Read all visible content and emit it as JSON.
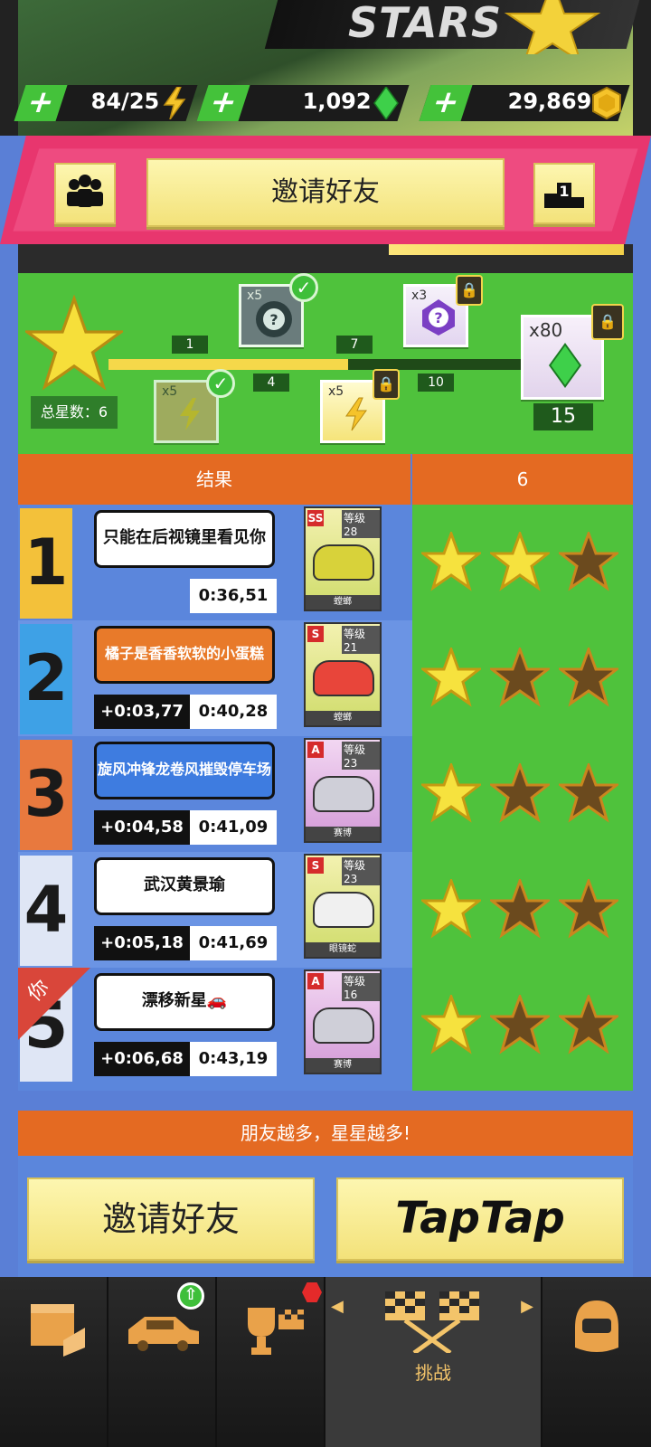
{
  "hero": {
    "title": "STARS"
  },
  "resources": [
    {
      "plus": "+",
      "value": "84/25",
      "icon": "lightning-icon"
    },
    {
      "plus": "+",
      "value": "1,092",
      "icon": "green-gem-icon"
    },
    {
      "plus": "+",
      "value": "29,869",
      "icon": "gold-coin-icon"
    }
  ],
  "topbar": {
    "invite_label": "邀请好友",
    "rank_value": "1"
  },
  "progress": {
    "total_label": "总星数：6",
    "milestones": [
      "1",
      "4",
      "7",
      "10",
      "15"
    ],
    "rewards": [
      {
        "mult": "x5",
        "kind": "lightning",
        "claimed": true
      },
      {
        "mult": "x5",
        "kind": "mystery-tire",
        "claimed": true
      },
      {
        "mult": "x5",
        "kind": "lightning",
        "claimed": false
      },
      {
        "mult": "x3",
        "kind": "mystery-gem",
        "claimed": false
      },
      {
        "mult": "x80",
        "kind": "green-gem",
        "claimed": false
      }
    ]
  },
  "table": {
    "header_result": "结果",
    "header_score": "6",
    "rows": [
      {
        "rank": "1",
        "name": "只能在后视镜里看见你",
        "gap": "",
        "time": "0:36,51",
        "car_class": "SS",
        "level": "等级28",
        "car_name": "螳螂",
        "stars": 2,
        "rank_color": "#f3c13a",
        "plate_color": "#ffffff",
        "car_color": "#d8d23a"
      },
      {
        "rank": "2",
        "name": "橘子是香香软软的小蛋糕",
        "gap": "+0:03,77",
        "time": "0:40,28",
        "car_class": "S",
        "level": "等级21",
        "car_name": "螳螂",
        "stars": 1,
        "rank_color": "#3ea1e6",
        "plate_color": "#e87a2a",
        "car_color": "#e8453a"
      },
      {
        "rank": "3",
        "name": "旋风冲锋龙卷风摧毁停车场",
        "gap": "+0:04,58",
        "time": "0:41,09",
        "car_class": "A",
        "level": "等级23",
        "car_name": "赛博",
        "stars": 1,
        "rank_color": "#e8793e",
        "plate_color": "#3e7ce0",
        "car_color": "#cfcfd8"
      },
      {
        "rank": "4",
        "name": "武汉黄景瑜",
        "gap": "+0:05,18",
        "time": "0:41,69",
        "car_class": "S",
        "level": "等级23",
        "car_name": "眼镜蛇",
        "stars": 1,
        "rank_color": "#dfe6f5",
        "plate_color": "#ffffff",
        "car_color": "#f0f0f0"
      },
      {
        "rank": "5",
        "name": "漂移新星🚗",
        "gap": "+0:06,68",
        "time": "0:43,19",
        "car_class": "A",
        "level": "等级16",
        "car_name": "赛博",
        "stars": 1,
        "rank_color": "#dfe6f5",
        "plate_color": "#ffffff",
        "car_color": "#cfcfd8",
        "you_label": "你"
      }
    ]
  },
  "footer": {
    "banner": "朋友越多，星星越多!",
    "invite_label": "邀请好友",
    "taptap_label": "TapTap"
  },
  "nav": {
    "challenge_label": "挑战"
  }
}
